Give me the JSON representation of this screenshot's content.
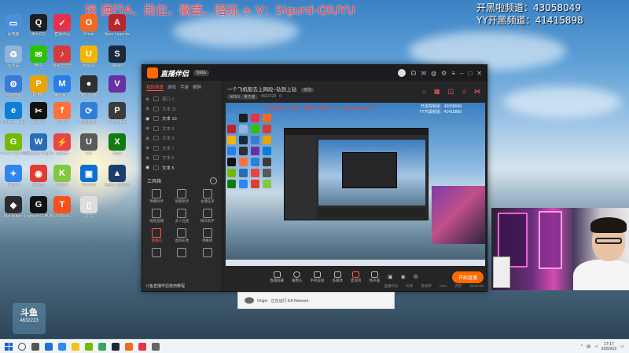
{
  "overlay": {
    "promo": "接 通行A、段位、徽章、陪玩 + V：Sigurd-QIUYU",
    "channel1": "开黑啦频道：43058049",
    "channel2": "YY开黑频道：41415898"
  },
  "desktop_icons": [
    {
      "label": "此电脑",
      "color": "#4a8fd8",
      "glyph": "▭"
    },
    {
      "label": "腾讯QQ",
      "color": "#1e1e1e",
      "glyph": "Q"
    },
    {
      "label": "直播伴侣",
      "color": "#e8304a",
      "glyph": "✓"
    },
    {
      "label": "Origin",
      "color": "#f26a21",
      "glyph": "O"
    },
    {
      "label": "Apex Legends",
      "color": "#b8262c",
      "glyph": "A"
    },
    {
      "label": "回收站",
      "color": "#8fb6d9",
      "glyph": "♻"
    },
    {
      "label": "微信",
      "color": "#2dc100",
      "glyph": "✉"
    },
    {
      "label": "网易云音乐",
      "color": "#d53b3b",
      "glyph": "♪"
    },
    {
      "label": "网易UU",
      "color": "#f4b400",
      "glyph": "U"
    },
    {
      "label": "Steam",
      "color": "#1b2838",
      "glyph": "S"
    },
    {
      "label": "控制面板",
      "color": "#3a7bd5",
      "glyph": "⚙"
    },
    {
      "label": "PUBG",
      "color": "#e9a400",
      "glyph": "P"
    },
    {
      "label": "腾讯会议",
      "color": "#2b7de9",
      "glyph": "M"
    },
    {
      "label": "OBS Studio",
      "color": "#302e31",
      "glyph": "●"
    },
    {
      "label": "VS",
      "color": "#6a2fa3",
      "glyph": "V"
    },
    {
      "label": "Microsoft Edge",
      "color": "#0c7ed6",
      "glyph": "e"
    },
    {
      "label": "CapCut",
      "color": "#111",
      "glyph": "✂"
    },
    {
      "label": "Firefox",
      "color": "#ff7139",
      "glyph": "f"
    },
    {
      "label": "UU加速器",
      "color": "#2f7fd9",
      "glyph": "⟳"
    },
    {
      "label": "PUBG Lite",
      "color": "#3b3b3b",
      "glyph": "P"
    },
    {
      "label": "GeForce Experience",
      "color": "#76b900",
      "glyph": "G"
    },
    {
      "label": "Wallpaper Engine",
      "color": "#2a6db5",
      "glyph": "W"
    },
    {
      "label": "加速器",
      "color": "#e94545",
      "glyph": "⚡"
    },
    {
      "label": "UU",
      "color": "#5a5a5a",
      "glyph": "U"
    },
    {
      "label": "Xbox",
      "color": "#107c10",
      "glyph": "X"
    },
    {
      "label": "Tencent",
      "color": "#2f86f3",
      "glyph": "✦"
    },
    {
      "label": "网易云",
      "color": "#e03c31",
      "glyph": "◉"
    },
    {
      "label": "KOOK",
      "color": "#83c742",
      "glyph": "K"
    },
    {
      "label": "Remote",
      "color": "#0b70cf",
      "glyph": "▣"
    },
    {
      "label": "Apex Legends",
      "color": "#1a3f6e",
      "glyph": "▲"
    },
    {
      "label": "Blockchain",
      "color": "#2b2b2b",
      "glyph": "◆"
    },
    {
      "label": "Logitech G HUB",
      "color": "#111",
      "glyph": "G"
    },
    {
      "label": "ToDesk",
      "color": "#f6511d",
      "glyph": "T"
    },
    {
      "label": "文件",
      "color": "#dddddd",
      "glyph": "▯"
    }
  ],
  "app": {
    "brand": "直播伴侣",
    "version": "beta",
    "side_tabs": [
      "我的场景",
      "游戏",
      "手游",
      "横屏"
    ],
    "sources": [
      {
        "label": "窗口 1",
        "on": false
      },
      {
        "label": "文本 11",
        "on": false
      },
      {
        "label": "文本 10",
        "on": true
      },
      {
        "label": "文本 9",
        "on": false
      },
      {
        "label": "文本 8",
        "on": false
      },
      {
        "label": "文本 7",
        "on": false
      },
      {
        "label": "文本 6",
        "on": false
      },
      {
        "label": "文本 5",
        "on": true
      }
    ],
    "tools_title": "工具箱",
    "tools": [
      "弹幕助手",
      "观察助手",
      "主播任务",
      "视频直播",
      "多人连麦",
      "精华助手",
      "直播间",
      "虚拟形象",
      "弹幕库",
      "",
      "",
      ""
    ],
    "side_footer": "斗鱼直播伴侣使用教程",
    "room_title": "一个飞机般去上网段~钻到上钻",
    "room_tag": "修改",
    "room_game": "APEX · 英杰者",
    "room_id": "4632223",
    "room_count": "0",
    "ctrl_buttons": [
      "直播屏幕",
      "摄像头",
      "手机投屏",
      "多媒体",
      "麦克风",
      "扬声器"
    ],
    "live_button": "开始直播",
    "status_items": [
      "直播时长",
      "码率",
      "丢帧率",
      "CPU",
      "内存",
      "00:00:00"
    ]
  },
  "origin": {
    "text": "Origin · 正在运行 EA Network"
  },
  "watermark": {
    "line1": "斗鱼",
    "line2": "4632223"
  },
  "taskbar": {
    "time": "17:17",
    "date": "2022/6/2"
  }
}
